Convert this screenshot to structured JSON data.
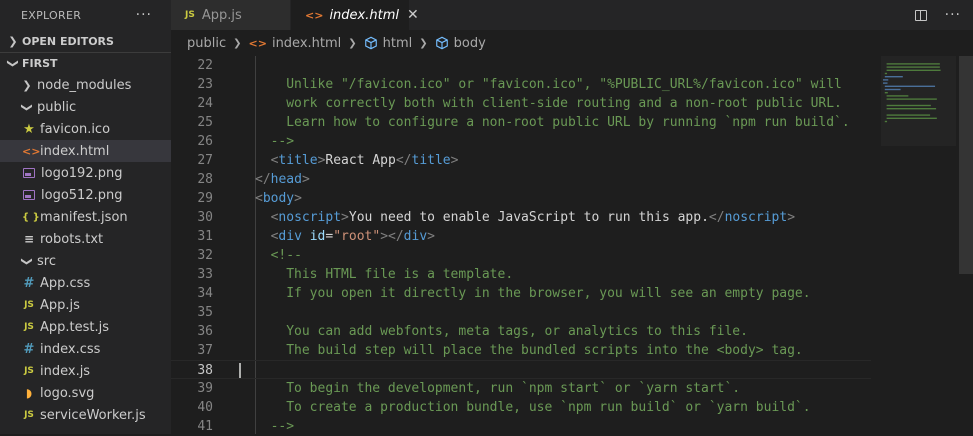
{
  "sidebar": {
    "title": "EXPLORER",
    "more": "···",
    "open_editors": "OPEN EDITORS",
    "project": "FIRST",
    "tree": [
      {
        "label": "node_modules",
        "kind": "folder",
        "open": false,
        "indent": 1
      },
      {
        "label": "public",
        "kind": "folder",
        "open": true,
        "indent": 1
      },
      {
        "label": "favicon.ico",
        "kind": "ico",
        "indent": 2
      },
      {
        "label": "index.html",
        "kind": "html",
        "indent": 2,
        "selected": true
      },
      {
        "label": "logo192.png",
        "kind": "png",
        "indent": 2
      },
      {
        "label": "logo512.png",
        "kind": "png",
        "indent": 2
      },
      {
        "label": "manifest.json",
        "kind": "json",
        "indent": 2
      },
      {
        "label": "robots.txt",
        "kind": "txt",
        "indent": 2
      },
      {
        "label": "src",
        "kind": "folder",
        "open": true,
        "indent": 1
      },
      {
        "label": "App.css",
        "kind": "css",
        "indent": 2
      },
      {
        "label": "App.js",
        "kind": "js",
        "indent": 2
      },
      {
        "label": "App.test.js",
        "kind": "js",
        "indent": 2
      },
      {
        "label": "index.css",
        "kind": "css",
        "indent": 2
      },
      {
        "label": "index.js",
        "kind": "js",
        "indent": 2
      },
      {
        "label": "logo.svg",
        "kind": "svg",
        "indent": 2
      },
      {
        "label": "serviceWorker.js",
        "kind": "js",
        "indent": 2
      }
    ]
  },
  "tabs": [
    {
      "label": "App.js",
      "kind": "js",
      "active": false
    },
    {
      "label": "index.html",
      "kind": "html",
      "active": true,
      "close": "✕"
    }
  ],
  "breadcrumb": [
    "public",
    "index.html",
    "html",
    "body"
  ],
  "code": [
    {
      "n": "22",
      "indent": 0,
      "segs": []
    },
    {
      "n": "23",
      "indent": 4,
      "segs": [
        [
          "c",
          "Unlike \"/favicon.ico\" or \"favicon.ico\", \"%PUBLIC_URL%/favicon.ico\" will"
        ]
      ]
    },
    {
      "n": "24",
      "indent": 4,
      "segs": [
        [
          "c",
          "work correctly both with client-side routing and a non-root public URL."
        ]
      ]
    },
    {
      "n": "25",
      "indent": 4,
      "segs": [
        [
          "c",
          "Learn how to configure a non-root public URL by running `npm run build`."
        ]
      ]
    },
    {
      "n": "26",
      "indent": 2,
      "segs": [
        [
          "c",
          "-->"
        ]
      ]
    },
    {
      "n": "27",
      "indent": 2,
      "segs": [
        [
          "b",
          "<"
        ],
        [
          "t",
          "title"
        ],
        [
          "b",
          ">"
        ],
        [
          "x",
          "React App"
        ],
        [
          "b",
          "</"
        ],
        [
          "t",
          "title"
        ],
        [
          "b",
          ">"
        ]
      ]
    },
    {
      "n": "28",
      "indent": 0,
      "segs": [
        [
          "b",
          "</"
        ],
        [
          "t",
          "head"
        ],
        [
          "b",
          ">"
        ]
      ]
    },
    {
      "n": "29",
      "indent": 0,
      "segs": [
        [
          "b",
          "<"
        ],
        [
          "t",
          "body"
        ],
        [
          "b",
          ">"
        ]
      ]
    },
    {
      "n": "30",
      "indent": 2,
      "segs": [
        [
          "b",
          "<"
        ],
        [
          "t",
          "noscript"
        ],
        [
          "b",
          ">"
        ],
        [
          "x",
          "You need to enable JavaScript to run this app."
        ],
        [
          "b",
          "</"
        ],
        [
          "t",
          "noscript"
        ],
        [
          "b",
          ">"
        ]
      ]
    },
    {
      "n": "31",
      "indent": 2,
      "segs": [
        [
          "b",
          "<"
        ],
        [
          "t",
          "div"
        ],
        [
          "x",
          " "
        ],
        [
          "a",
          "id"
        ],
        [
          "x",
          "="
        ],
        [
          "s",
          "\"root\""
        ],
        [
          "b",
          "></"
        ],
        [
          "t",
          "div"
        ],
        [
          "b",
          ">"
        ]
      ]
    },
    {
      "n": "32",
      "indent": 2,
      "segs": [
        [
          "c",
          "<!--"
        ]
      ]
    },
    {
      "n": "33",
      "indent": 4,
      "segs": [
        [
          "c",
          "This HTML file is a template."
        ]
      ]
    },
    {
      "n": "34",
      "indent": 4,
      "segs": [
        [
          "c",
          "If you open it directly in the browser, you will see an empty page."
        ]
      ]
    },
    {
      "n": "35",
      "indent": 0,
      "segs": []
    },
    {
      "n": "36",
      "indent": 4,
      "segs": [
        [
          "c",
          "You can add webfonts, meta tags, or analytics to this file."
        ]
      ]
    },
    {
      "n": "37",
      "indent": 4,
      "segs": [
        [
          "c",
          "The build step will place the bundled scripts into the <body> tag."
        ]
      ]
    },
    {
      "n": "38",
      "indent": 0,
      "segs": [],
      "current": true
    },
    {
      "n": "39",
      "indent": 4,
      "segs": [
        [
          "c",
          "To begin the development, run `npm start` or `yarn start`."
        ]
      ]
    },
    {
      "n": "40",
      "indent": 4,
      "segs": [
        [
          "c",
          "To create a production bundle, use `npm run build` or `yarn build`."
        ]
      ]
    },
    {
      "n": "41",
      "indent": 2,
      "segs": [
        [
          "c",
          "-->"
        ]
      ]
    }
  ]
}
